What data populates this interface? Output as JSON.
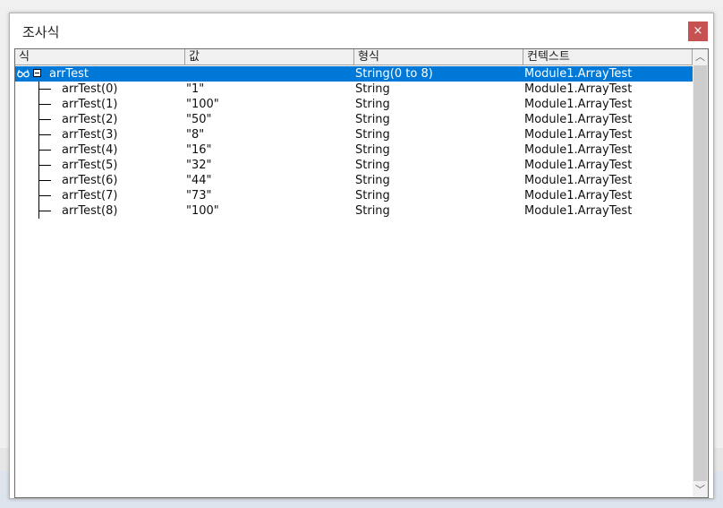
{
  "window": {
    "title": "조사식",
    "close_label": "×"
  },
  "columns": [
    "식",
    "값",
    "형식",
    "컨텍스트"
  ],
  "parent": {
    "expression": "arrTest",
    "value": "",
    "type": "String(0 to 8)",
    "context": "Module1.ArrayTest"
  },
  "children": [
    {
      "expression": "arrTest(0)",
      "value": "\"1\"",
      "type": "String",
      "context": "Module1.ArrayTest"
    },
    {
      "expression": "arrTest(1)",
      "value": "\"100\"",
      "type": "String",
      "context": "Module1.ArrayTest"
    },
    {
      "expression": "arrTest(2)",
      "value": "\"50\"",
      "type": "String",
      "context": "Module1.ArrayTest"
    },
    {
      "expression": "arrTest(3)",
      "value": "\"8\"",
      "type": "String",
      "context": "Module1.ArrayTest"
    },
    {
      "expression": "arrTest(4)",
      "value": "\"16\"",
      "type": "String",
      "context": "Module1.ArrayTest"
    },
    {
      "expression": "arrTest(5)",
      "value": "\"32\"",
      "type": "String",
      "context": "Module1.ArrayTest"
    },
    {
      "expression": "arrTest(6)",
      "value": "\"44\"",
      "type": "String",
      "context": "Module1.ArrayTest"
    },
    {
      "expression": "arrTest(7)",
      "value": "\"73\"",
      "type": "String",
      "context": "Module1.ArrayTest"
    },
    {
      "expression": "arrTest(8)",
      "value": "\"100\"",
      "type": "String",
      "context": "Module1.ArrayTest"
    }
  ],
  "scrollbar": {
    "up_glyph": "︿",
    "down_glyph": "﹀"
  },
  "colors": {
    "selection": "#0078d7",
    "close_button": "#c75050"
  }
}
